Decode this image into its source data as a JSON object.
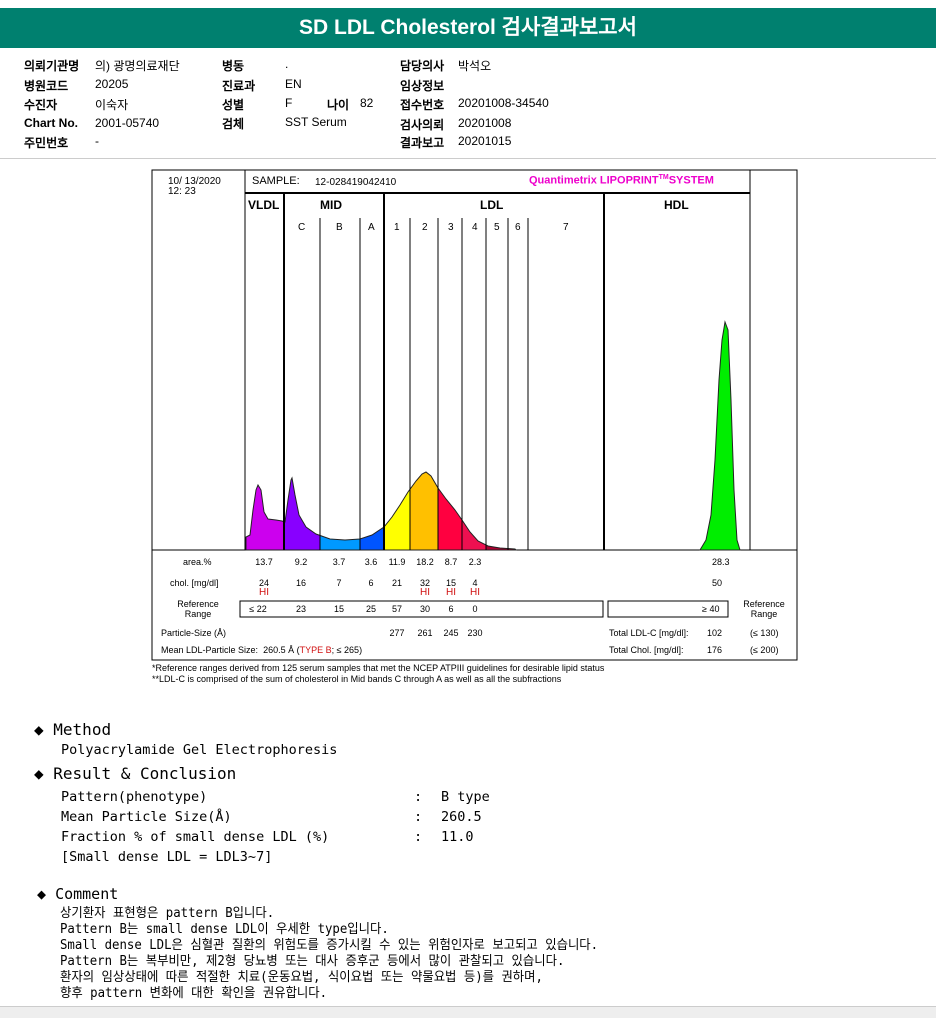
{
  "title": "SD LDL Cholesterol 검사결과보고서",
  "info": {
    "col1": [
      {
        "label": "의뢰기관명",
        "value": "의) 광명의료재단"
      },
      {
        "label": "병원코드",
        "value": "20205"
      },
      {
        "label": "수진자",
        "value": "이숙자"
      },
      {
        "label": "Chart No.",
        "value": "2001-05740"
      },
      {
        "label": "주민번호",
        "value": "-"
      }
    ],
    "col2": [
      {
        "label": "병동",
        "value": "."
      },
      {
        "label": "진료과",
        "value": "EN"
      },
      {
        "label": "성별",
        "value": "F"
      },
      {
        "label": "검체",
        "value": "SST Serum"
      }
    ],
    "age": {
      "label": "나이",
      "value": "82"
    },
    "col3": [
      {
        "label": "담당의사",
        "value": "박석오"
      },
      {
        "label": "임상정보",
        "value": ""
      },
      {
        "label": "접수번호",
        "value": "20201008-34540"
      },
      {
        "label": "검사의뢰",
        "value": "20201008"
      },
      {
        "label": "결과보고",
        "value": "20201015"
      }
    ]
  },
  "report": {
    "date": "10/ 13/2020",
    "time": "12: 23",
    "sample_label": "SAMPLE:",
    "sample": "12-028419042410",
    "system": "Quantimetrix LIPOPRINT",
    "tm": "TM",
    "system2": "SYSTEM",
    "groups": [
      "VLDL",
      "MID",
      "LDL",
      "HDL"
    ],
    "bands": [
      "C",
      "B",
      "A",
      "1",
      "2",
      "3",
      "4",
      "5",
      "6",
      "7"
    ],
    "row_labels": {
      "area": "area.%",
      "chol": "chol. [mg/dl]",
      "ref": "Reference Range",
      "ref2": "Reference Range",
      "size": "Particle-Size (Å)",
      "mean": "Mean LDL-Particle Size:"
    },
    "area": [
      "13.7",
      "9.2",
      "3.7",
      "3.6",
      "11.9",
      "18.2",
      "8.7",
      "2.3"
    ],
    "chol": [
      "24",
      "16",
      "7",
      "6",
      "21",
      "32",
      "15",
      "4"
    ],
    "flags": [
      "HI",
      "",
      "",
      "",
      "",
      "HI",
      "HI",
      "HI"
    ],
    "ref": [
      "≤ 22",
      "23",
      "15",
      "25",
      "57",
      "30",
      "6",
      "0"
    ],
    "size": [
      "277",
      "261",
      "245",
      "230"
    ],
    "hdl": {
      "area": "28.3",
      "chol": "50",
      "ref": "≥ 40"
    },
    "mean_value": "260.5 Å (",
    "type": "TYPE B",
    "mean_ref": "; ≤ 265)",
    "total_ldl_label": "Total LDL-C [mg/dl]:",
    "total_ldl": "102",
    "total_ldl_ref": "(≤ 130)",
    "total_chol_label": "Total Chol. [mg/dl]:",
    "total_chol": "176",
    "total_chol_ref": "(≤ 200)",
    "note1": "*Reference ranges derived from 125 serum samples that met the NCEP ATPIII guidelines for desirable lipid status",
    "note2": "**LDL-C is comprised of the sum of cholesterol in Mid bands C through A as well as all the subfractions",
    "colors": {
      "vldl": "#cc00ee",
      "c": "#8800ff",
      "b": "#0099ff",
      "a": "#0055ff",
      "l1": "#ffff00",
      "l2": "#ffc000",
      "l3": "#ff0040",
      "l4": "#ee1050",
      "l5": "#aa0030",
      "hdl": "#00ee00",
      "brand": "#ee00cc"
    }
  },
  "method": {
    "heading": "Method",
    "text": "Polyacrylamide Gel Electrophoresis"
  },
  "result": {
    "heading": "Result & Conclusion",
    "rows": [
      {
        "label": "Pattern(phenotype)",
        "value": "B type"
      },
      {
        "label": "Mean Particle Size(Å)",
        "value": "260.5"
      },
      {
        "label": "Fraction % of small dense LDL (%)",
        "value": "11.0"
      }
    ],
    "colon": ":",
    "note": "[Small dense LDL = LDL3~7]"
  },
  "comment": {
    "heading": "Comment",
    "lines": [
      "상기환자 표현형은 pattern B입니다.",
      "Pattern B는 small dense LDL이 우세한 type입니다.",
      "Small dense LDL은 심혈관 질환의 위험도를 증가시킬 수 있는 위험인자로 보고되고 있습니다.",
      "Pattern B는 복부비만, 제2형 당뇨병 또는 대사 증후군 등에서 많이 관찰되고 있습니다.",
      "환자의 임상상태에 따른 적절한 치료(운동요법, 식이요법 또는 약물요법 등)를 권하며,",
      "향후 pattern 변화에 대한 확인을 권유합니다."
    ]
  }
}
